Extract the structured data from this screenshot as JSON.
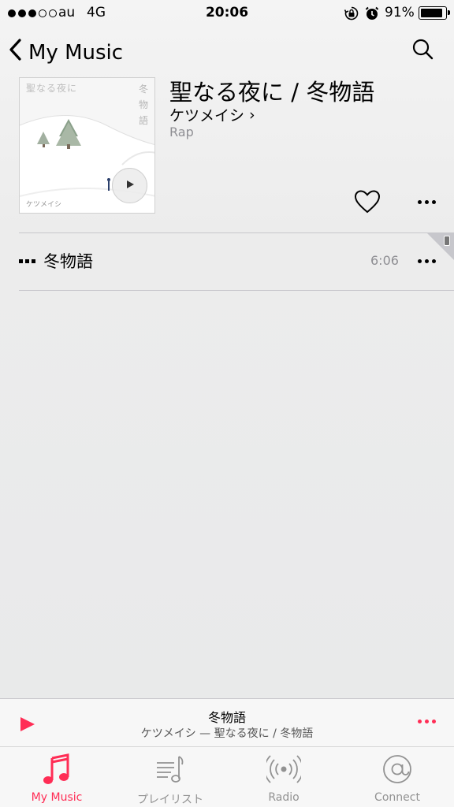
{
  "status_bar": {
    "carrier": "au",
    "network": "4G",
    "time": "20:06",
    "battery": "91%",
    "battery_level": 0.91,
    "signal_bars_filled": 3,
    "signal_bars_total": 5
  },
  "nav": {
    "back_label": "My Music",
    "back_icon": "chevron-left-icon",
    "search_icon": "search-icon"
  },
  "album": {
    "title": "聖なる夜に / 冬物語",
    "artist": "ケツメイシ",
    "artist_chevron": "›",
    "genre": "Rap",
    "art_title": "聖なる夜に",
    "art_subtitle": "冬物語",
    "art_artist": "ケツメイシ"
  },
  "tracks": [
    {
      "name": "冬物語",
      "duration": "6:06"
    }
  ],
  "mini_player": {
    "title": "冬物語",
    "subtitle": "ケツメイシ — 聖なる夜に / 冬物語"
  },
  "tabs": [
    {
      "label": "My Music",
      "icon": "music-note-icon",
      "active": true
    },
    {
      "label": "プレイリスト",
      "icon": "playlist-icon",
      "active": false
    },
    {
      "label": "Radio",
      "icon": "radio-icon",
      "active": false
    },
    {
      "label": "Connect",
      "icon": "at-sign-icon",
      "active": false
    }
  ],
  "colors": {
    "accent": "#ff2d55",
    "secondary_text": "#8e8e93",
    "divider": "#c8c7cc"
  }
}
